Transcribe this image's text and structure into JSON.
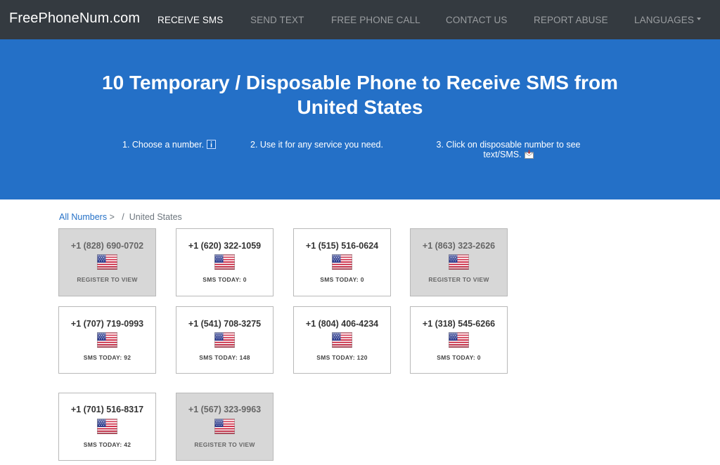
{
  "nav": {
    "brand": "FreePhoneNum.com",
    "items": [
      {
        "label": "RECEIVE SMS",
        "active": true
      },
      {
        "label": "SEND TEXT",
        "active": false
      },
      {
        "label": "FREE PHONE CALL",
        "active": false
      },
      {
        "label": "CONTACT US",
        "active": false
      },
      {
        "label": "REPORT ABUSE",
        "active": false
      },
      {
        "label": "LANGUAGES",
        "active": false
      }
    ]
  },
  "hero": {
    "title_line1": "10 Temporary / Disposable Phone to Receive SMS from",
    "title_line2": "United States",
    "steps": [
      {
        "text": "1. Choose a number.",
        "icon": "info-icon"
      },
      {
        "text": "2. Use it for any service you need."
      },
      {
        "text_line1": "3. Click on disposable number to see",
        "text_line2": "text/SMS.",
        "icon": "inbox-icon"
      }
    ]
  },
  "breadcrumb": {
    "link": "All Numbers",
    "arrow": ">",
    "separator": "/",
    "current": "United States"
  },
  "numbers": [
    {
      "number": "+1 (828) 690-0702",
      "status": "REGISTER TO VIEW",
      "locked": true
    },
    {
      "number": "+1 (620) 322-1059",
      "status": "SMS TODAY: 0",
      "locked": false
    },
    {
      "number": "+1 (515) 516-0624",
      "status": "SMS TODAY: 0",
      "locked": false
    },
    {
      "number": "+1 (863) 323-2626",
      "status": "REGISTER TO VIEW",
      "locked": true
    },
    {
      "number": "+1 (707) 719-0993",
      "status": "SMS TODAY: 92",
      "locked": false
    },
    {
      "number": "+1 (541) 708-3275",
      "status": "SMS TODAY: 148",
      "locked": false
    },
    {
      "number": "+1 (804) 406-4234",
      "status": "SMS TODAY: 120",
      "locked": false
    },
    {
      "number": "+1 (318) 545-6266",
      "status": "SMS TODAY: 0",
      "locked": false
    },
    {
      "number": "+1 (701) 516-8317",
      "status": "SMS TODAY: 42",
      "locked": false
    },
    {
      "number": "+1 (567) 323-9963",
      "status": "REGISTER TO VIEW",
      "locked": true
    }
  ],
  "colors": {
    "navbar": "#343a40",
    "hero": "#2470c7",
    "link": "#2470c7",
    "locked_card": "#d7d7d7"
  }
}
